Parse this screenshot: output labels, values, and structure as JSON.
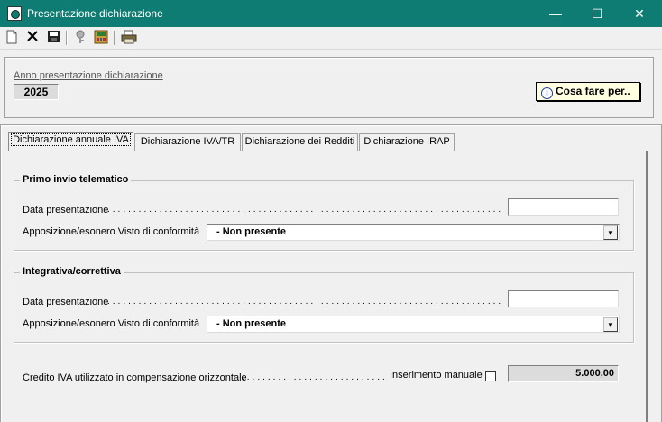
{
  "window": {
    "title": "Presentazione dichiarazione",
    "minimize": "—",
    "maximize": "☐",
    "close": "✕"
  },
  "toolbar": {
    "icons": [
      "new-document-icon",
      "delete-icon",
      "save-icon",
      "key-icon",
      "calculator-icon",
      "print-icon"
    ]
  },
  "header": {
    "anno_label": "Anno presentazione dichiarazione",
    "anno_value": "2025",
    "cosa_fare_label": "Cosa fare per.."
  },
  "tabs": [
    {
      "label": "Dichiarazione annuale IVA",
      "active": true
    },
    {
      "label": "Dichiarazione IVA/TR",
      "active": false
    },
    {
      "label": "Dichiarazione dei Redditi",
      "active": false
    },
    {
      "label": "Dichiarazione IRAP",
      "active": false
    }
  ],
  "primo_invio": {
    "title": "Primo invio telematico",
    "data_label": "Data presentazione",
    "data_value": "",
    "visto_label": "Apposizione/esonero Visto di conformità",
    "visto_value": "- Non presente"
  },
  "integrativa": {
    "title": "Integrativa/correttiva",
    "data_label": "Data presentazione",
    "data_value": "",
    "visto_label": "Apposizione/esonero Visto di conformità",
    "visto_value": "- Non presente"
  },
  "credito": {
    "label": "Credito IVA utilizzato in compensazione orizzontale",
    "inserimento_label": "Inserimento manuale",
    "inserimento_checked": false,
    "value": "5.000,00"
  },
  "colors": {
    "titlebar": "#0f7c74",
    "window_bg": "#f0f0f0",
    "tooltip_button_bg": "#ffffe1"
  }
}
